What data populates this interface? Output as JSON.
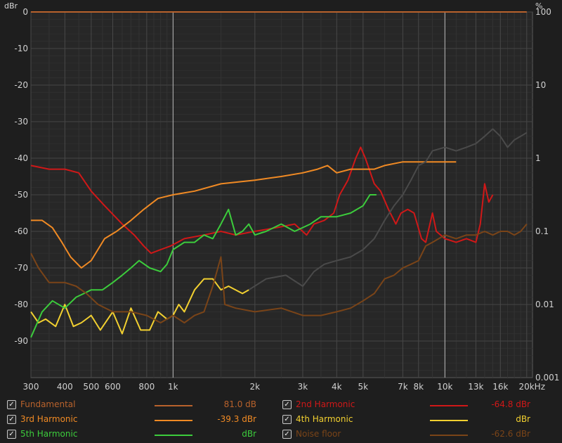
{
  "chart_data": {
    "type": "line",
    "y_left_unit": "dBr",
    "y_right_unit": "%",
    "x_ticks": [
      {
        "value": 300,
        "label": "300"
      },
      {
        "value": 400,
        "label": "400"
      },
      {
        "value": 500,
        "label": "500"
      },
      {
        "value": 600,
        "label": "600"
      },
      {
        "value": 800,
        "label": "800"
      },
      {
        "value": 1000,
        "label": "1k"
      },
      {
        "value": 2000,
        "label": "2k"
      },
      {
        "value": 3000,
        "label": "3k"
      },
      {
        "value": 4000,
        "label": "4k"
      },
      {
        "value": 5000,
        "label": "5k"
      },
      {
        "value": 7000,
        "label": "7k"
      },
      {
        "value": 8000,
        "label": "8k"
      },
      {
        "value": 10000,
        "label": "10k"
      },
      {
        "value": 13000,
        "label": "13k"
      },
      {
        "value": 16000,
        "label": "16k"
      },
      {
        "value": 20000,
        "label": "20kHz"
      }
    ],
    "x_minor_ticks": [
      700,
      900,
      5000,
      6000,
      9000
    ],
    "x_range": [
      300,
      21000
    ],
    "x_scale": "log",
    "y_range": [
      -100,
      0
    ],
    "y_ticks_left": [
      0,
      -10,
      -20,
      -30,
      -40,
      -50,
      -60,
      -70,
      -80,
      -90
    ],
    "y_ticks_right": [
      {
        "value": 100,
        "label": "100"
      },
      {
        "value": 10,
        "label": "10"
      },
      {
        "value": 1,
        "label": "1"
      },
      {
        "value": 0.1,
        "label": "0.1"
      },
      {
        "value": 0.01,
        "label": "0.01"
      },
      {
        "value": 0.001,
        "label": "0.001"
      }
    ],
    "y_right_scale": "log",
    "grid": true,
    "series": [
      {
        "name": "Fundamental",
        "color": "#b8622c",
        "points": [
          [
            300,
            0
          ],
          [
            20000,
            0
          ]
        ]
      },
      {
        "name": "2nd Harmonic",
        "color": "#d01818",
        "points": [
          [
            300,
            -42
          ],
          [
            350,
            -43
          ],
          [
            400,
            -43
          ],
          [
            450,
            -44
          ],
          [
            500,
            -49
          ],
          [
            560,
            -53
          ],
          [
            650,
            -58
          ],
          [
            720,
            -61
          ],
          [
            780,
            -64
          ],
          [
            830,
            -66
          ],
          [
            900,
            -65
          ],
          [
            980,
            -64
          ],
          [
            1100,
            -62
          ],
          [
            1300,
            -61
          ],
          [
            1500,
            -60
          ],
          [
            1700,
            -61
          ],
          [
            2000,
            -60
          ],
          [
            2400,
            -59
          ],
          [
            2800,
            -58
          ],
          [
            3100,
            -61
          ],
          [
            3300,
            -58
          ],
          [
            3600,
            -57
          ],
          [
            3900,
            -55
          ],
          [
            4100,
            -50
          ],
          [
            4400,
            -46
          ],
          [
            4700,
            -40
          ],
          [
            4900,
            -37
          ],
          [
            5100,
            -40
          ],
          [
            5500,
            -47
          ],
          [
            5800,
            -49
          ],
          [
            6200,
            -54
          ],
          [
            6600,
            -58
          ],
          [
            6900,
            -55
          ],
          [
            7300,
            -54
          ],
          [
            7700,
            -55
          ],
          [
            8200,
            -62
          ],
          [
            8500,
            -63
          ],
          [
            9000,
            -55
          ],
          [
            9300,
            -60
          ],
          [
            10000,
            -62
          ],
          [
            11000,
            -63
          ],
          [
            12000,
            -62
          ],
          [
            13000,
            -63
          ],
          [
            13500,
            -58
          ],
          [
            14000,
            -47
          ],
          [
            14500,
            -52
          ],
          [
            15000,
            -50
          ]
        ]
      },
      {
        "name": "3rd Harmonic",
        "color": "#f08a24",
        "points": [
          [
            300,
            -57
          ],
          [
            330,
            -57
          ],
          [
            360,
            -59
          ],
          [
            390,
            -63
          ],
          [
            420,
            -67
          ],
          [
            460,
            -70
          ],
          [
            500,
            -68
          ],
          [
            560,
            -62
          ],
          [
            620,
            -60
          ],
          [
            700,
            -57
          ],
          [
            780,
            -54
          ],
          [
            880,
            -51
          ],
          [
            1000,
            -50
          ],
          [
            1200,
            -49
          ],
          [
            1500,
            -47
          ],
          [
            2000,
            -46
          ],
          [
            2500,
            -45
          ],
          [
            3000,
            -44
          ],
          [
            3400,
            -43
          ],
          [
            3700,
            -42
          ],
          [
            4000,
            -44
          ],
          [
            4500,
            -43
          ],
          [
            5000,
            -43
          ],
          [
            5500,
            -43
          ],
          [
            6000,
            -42
          ],
          [
            7000,
            -41
          ],
          [
            8000,
            -41
          ],
          [
            9000,
            -41
          ],
          [
            10000,
            -41
          ],
          [
            11000,
            -41
          ]
        ]
      },
      {
        "name": "4th Harmonic",
        "color": "#f2d030",
        "points": [
          [
            300,
            -82
          ],
          [
            320,
            -85
          ],
          [
            340,
            -84
          ],
          [
            370,
            -86
          ],
          [
            400,
            -80
          ],
          [
            430,
            -86
          ],
          [
            460,
            -85
          ],
          [
            500,
            -83
          ],
          [
            540,
            -87
          ],
          [
            600,
            -82
          ],
          [
            650,
            -88
          ],
          [
            700,
            -81
          ],
          [
            760,
            -87
          ],
          [
            820,
            -87
          ],
          [
            880,
            -82
          ],
          [
            950,
            -84
          ],
          [
            1000,
            -83
          ],
          [
            1050,
            -80
          ],
          [
            1100,
            -82
          ],
          [
            1200,
            -76
          ],
          [
            1300,
            -73
          ],
          [
            1400,
            -73
          ],
          [
            1500,
            -76
          ],
          [
            1600,
            -75
          ],
          [
            1800,
            -77
          ],
          [
            1900,
            -76
          ]
        ]
      },
      {
        "name": "5th Harmonic",
        "color": "#3ccc3c",
        "points": [
          [
            300,
            -89
          ],
          [
            330,
            -82
          ],
          [
            360,
            -79
          ],
          [
            400,
            -81
          ],
          [
            440,
            -78
          ],
          [
            470,
            -77
          ],
          [
            500,
            -76
          ],
          [
            550,
            -76
          ],
          [
            600,
            -74
          ],
          [
            650,
            -72
          ],
          [
            700,
            -70
          ],
          [
            750,
            -68
          ],
          [
            820,
            -70
          ],
          [
            900,
            -71
          ],
          [
            950,
            -69
          ],
          [
            1000,
            -65
          ],
          [
            1100,
            -63
          ],
          [
            1200,
            -63
          ],
          [
            1300,
            -61
          ],
          [
            1400,
            -62
          ],
          [
            1500,
            -58
          ],
          [
            1600,
            -54
          ],
          [
            1700,
            -61
          ],
          [
            1800,
            -60
          ],
          [
            1900,
            -58
          ],
          [
            2000,
            -61
          ],
          [
            2200,
            -60
          ],
          [
            2500,
            -58
          ],
          [
            2800,
            -60
          ],
          [
            3200,
            -58
          ],
          [
            3500,
            -56
          ],
          [
            4000,
            -56
          ],
          [
            4500,
            -55
          ],
          [
            5000,
            -53
          ],
          [
            5300,
            -50
          ],
          [
            5600,
            -50
          ]
        ]
      },
      {
        "name": "Noise floor",
        "color": "#7a4418",
        "points": [
          [
            300,
            -66
          ],
          [
            320,
            -70
          ],
          [
            350,
            -74
          ],
          [
            400,
            -74
          ],
          [
            440,
            -75
          ],
          [
            480,
            -77
          ],
          [
            530,
            -80
          ],
          [
            600,
            -82
          ],
          [
            700,
            -82
          ],
          [
            800,
            -83
          ],
          [
            900,
            -85
          ],
          [
            1000,
            -83
          ],
          [
            1100,
            -85
          ],
          [
            1200,
            -83
          ],
          [
            1300,
            -82
          ],
          [
            1400,
            -75
          ],
          [
            1500,
            -67
          ],
          [
            1550,
            -80
          ],
          [
            1700,
            -81
          ],
          [
            2000,
            -82
          ],
          [
            2500,
            -81
          ],
          [
            3000,
            -83
          ],
          [
            3500,
            -83
          ],
          [
            4000,
            -82
          ],
          [
            4500,
            -81
          ],
          [
            5000,
            -79
          ],
          [
            5500,
            -77
          ],
          [
            6000,
            -73
          ],
          [
            6500,
            -72
          ],
          [
            7000,
            -70
          ],
          [
            7500,
            -69
          ],
          [
            8000,
            -68
          ],
          [
            8500,
            -64
          ],
          [
            9000,
            -63
          ],
          [
            10000,
            -61
          ],
          [
            11000,
            -62
          ],
          [
            12000,
            -61
          ],
          [
            13000,
            -61
          ],
          [
            14000,
            -60
          ],
          [
            15000,
            -61
          ],
          [
            16000,
            -60
          ],
          [
            17000,
            -60
          ],
          [
            18000,
            -61
          ],
          [
            19000,
            -60
          ],
          [
            20000,
            -58
          ]
        ]
      },
      {
        "name": "",
        "color": "#4a4a4a",
        "points": [
          [
            1900,
            -76
          ],
          [
            2200,
            -73
          ],
          [
            2600,
            -72
          ],
          [
            3000,
            -75
          ],
          [
            3300,
            -71
          ],
          [
            3600,
            -69
          ],
          [
            4000,
            -68
          ],
          [
            4500,
            -67
          ],
          [
            5000,
            -65
          ],
          [
            5500,
            -62
          ],
          [
            6000,
            -57
          ],
          [
            6500,
            -53
          ],
          [
            7000,
            -50
          ],
          [
            7500,
            -46
          ],
          [
            8000,
            -42
          ],
          [
            8500,
            -41
          ],
          [
            9000,
            -38
          ],
          [
            10000,
            -37
          ],
          [
            11000,
            -38
          ],
          [
            12000,
            -37
          ],
          [
            13000,
            -36
          ],
          [
            14000,
            -34
          ],
          [
            15000,
            -32
          ],
          [
            16000,
            -34
          ],
          [
            17000,
            -37
          ],
          [
            18000,
            -35
          ],
          [
            19000,
            -34
          ],
          [
            20000,
            -33
          ]
        ]
      }
    ]
  },
  "legend": {
    "col1": [
      {
        "label": "Fundamental",
        "value": "81.0 dB",
        "checked": true
      },
      {
        "label": "3rd Harmonic",
        "value": "-39.3 dBr",
        "checked": true
      },
      {
        "label": "5th Harmonic",
        "value": "dBr",
        "checked": true
      }
    ],
    "col2": [
      {
        "label": "2nd Harmonic",
        "value": "-64.8 dBr",
        "checked": true
      },
      {
        "label": "4th Harmonic",
        "value": "dBr",
        "checked": true
      },
      {
        "label": "Noise floor",
        "value": "-62.6 dBr",
        "checked": true
      }
    ],
    "colors": {
      "Fundamental": "#b8622c",
      "3rd Harmonic": "#f08a24",
      "5th Harmonic": "#3ccc3c",
      "2nd Harmonic": "#d01818",
      "4th Harmonic": "#f2d030",
      "Noise floor": "#7a4418"
    }
  }
}
